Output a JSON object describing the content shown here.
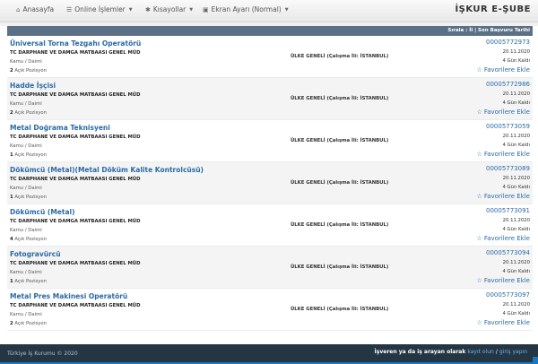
{
  "nav": {
    "home": "Anasayfa",
    "online": "Online İşlemler",
    "shortcuts": "Kısayollar",
    "screen": "Ekran Ayarı (Normal)",
    "brand": "İŞKUR E-ŞUBE"
  },
  "list": {
    "header": "Sırala : İl | Son Başvuru Tarihi",
    "jobs": [
      {
        "title": "Üniversal Torna Tezgahı Operatörü",
        "company": "TC DARPHANE VE DAMGA MATBAASI GENEL MÜD",
        "type": "Kamu / Daimi",
        "count": "2",
        "count_label": "Açık Pozisyon",
        "location": "ÜLKE GENELİ (Çalışma İli: İSTANBUL)",
        "number": "00005772973",
        "date": "20.11.2020",
        "days": "4 Gün Kaldı",
        "fav": "Favorilere Ekle"
      },
      {
        "title": "Hadde İşçisi",
        "company": "TC DARPHANE VE DAMGA MATBAASI GENEL MÜD",
        "type": "Kamu / Daimi",
        "count": "2",
        "count_label": "Açık Pozisyon",
        "location": "ÜLKE GENELİ (Çalışma İli: İSTANBUL)",
        "number": "00005772986",
        "date": "20.11.2020",
        "days": "4 Gün Kaldı",
        "fav": "Favorilere Ekle"
      },
      {
        "title": "Metal Doğrama Teknisyeni",
        "company": "TC DARPHANE VE DAMGA MATBAASI GENEL MÜD",
        "type": "Kamu / Daimi",
        "count": "1",
        "count_label": "Açık Pozisyon",
        "location": "ÜLKE GENELİ (Çalışma İli: İSTANBUL)",
        "number": "00005773059",
        "date": "20.11.2020",
        "days": "4 Gün Kaldı",
        "fav": "Favorilere Ekle"
      },
      {
        "title": "Dökümcü (Metal)(Metal Döküm Kalite Kontrolcüsü)",
        "company": "TC DARPHANE VE DAMGA MATBAASI GENEL MÜD",
        "type": "Kamu / Daimi",
        "count": "1",
        "count_label": "Açık Pozisyon",
        "location": "ÜLKE GENELİ (Çalışma İli: İSTANBUL)",
        "number": "00005773089",
        "date": "20.11.2020",
        "days": "4 Gün Kaldı",
        "fav": "Favorilere Ekle"
      },
      {
        "title": "Dökümcü (Metal)",
        "company": "TC DARPHANE VE DAMGA MATBAASI GENEL MÜD",
        "type": "Kamu / Daimi",
        "count": "4",
        "count_label": "Açık Pozisyon",
        "location": "ÜLKE GENELİ (Çalışma İli: İSTANBUL)",
        "number": "00005773091",
        "date": "20.11.2020",
        "days": "4 Gün Kaldı",
        "fav": "Favorilere Ekle"
      },
      {
        "title": "Fotogravürcü",
        "company": "TC DARPHANE VE DAMGA MATBAASI GENEL MÜD",
        "type": "Kamu / Daimi",
        "count": "1",
        "count_label": "Açık Pozisyon",
        "location": "ÜLKE GENELİ (Çalışma İli: İSTANBUL)",
        "number": "00005773094",
        "date": "20.11.2020",
        "days": "4 Gün Kaldı",
        "fav": "Favorilere Ekle"
      },
      {
        "title": "Metal Pres Makinesi Operatörü",
        "company": "TC DARPHANE VE DAMGA MATBAASI GENEL MÜD",
        "type": "Kamu / Daimi",
        "count": "2",
        "count_label": "Açık Pozisyon",
        "location": "ÜLKE GENELİ (Çalışma İli: İSTANBUL)",
        "number": "00005773097",
        "date": "20.11.2020",
        "days": "4 Gün Kaldı",
        "fav": "Favorilere Ekle"
      }
    ]
  },
  "footer": {
    "copyright": "Türkiye İş Kurumu © 2020",
    "prompt": "İşveren ya da iş arayan olarak",
    "login": "kayıt olun",
    "sep": "/",
    "enter": "giriş yapın"
  }
}
